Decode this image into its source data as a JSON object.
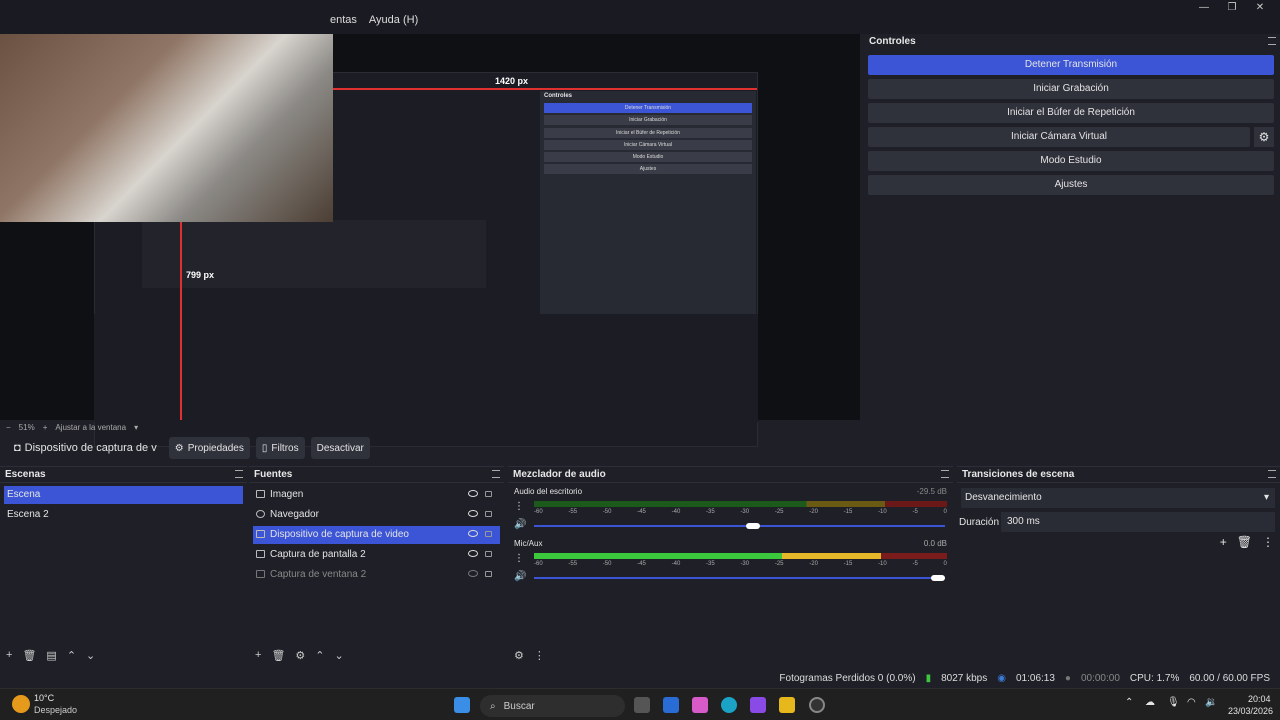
{
  "menu": {
    "items": [
      "entas",
      "Ayuda (H)"
    ]
  },
  "window_controls": {
    "minimize": "—",
    "maximize": "❐",
    "close": "✕"
  },
  "preview": {
    "inner_controls_title": "Controles",
    "inner_buttons": [
      "Detener Transmisión",
      "Iniciar Grabación",
      "Iniciar el Búfer de Repetición",
      "Iniciar Cámara Virtual",
      "Modo Estudio",
      "Ajustes"
    ],
    "measure_h": "1420 px",
    "measure_v": "799 px",
    "zoom": "51%",
    "fit_label": "Ajustar a la ventana"
  },
  "source_toolbar": {
    "source_name": "Dispositivo de captura de v",
    "properties": "Propiedades",
    "filters": "Filtros",
    "deactivate": "Desactivar"
  },
  "controls": {
    "title": "Controles",
    "buttons": [
      "Detener Transmisión",
      "Iniciar Grabación",
      "Iniciar el Búfer de Repetición",
      "Iniciar Cámara Virtual",
      "Modo Estudio",
      "Ajustes"
    ]
  },
  "scenes": {
    "title": "Escenas",
    "items": [
      "Escena",
      "Escena 2"
    ],
    "selected": 0
  },
  "sources": {
    "title": "Fuentes",
    "items": [
      "Imagen",
      "Navegador",
      "Dispositivo de captura de video",
      "Captura de pantalla 2",
      "Captura de ventana 2"
    ],
    "selected": 2
  },
  "mixer": {
    "title": "Mezclador de audio",
    "channels": [
      {
        "name": "Audio del escritorio",
        "db": "-29.5 dB",
        "level": 0.55
      },
      {
        "name": "Mic/Aux",
        "db": "0.0 dB",
        "level": 1.0
      }
    ],
    "scale": [
      "-60",
      "-55",
      "-50",
      "-45",
      "-40",
      "-35",
      "-30",
      "-25",
      "-20",
      "-15",
      "-10",
      "-5",
      "0"
    ]
  },
  "transitions": {
    "title": "Transiciones de escena",
    "type": "Desvanecimiento",
    "duration_label": "Duración",
    "duration_value": "300 ms"
  },
  "statusbar": {
    "dropped": "Fotogramas Perdidos 0 (0.0%)",
    "bitrate": "8027 kbps",
    "stream_time": "01:06:13",
    "rec_time": "00:00:00",
    "cpu": "CPU: 1.7%",
    "fps": "60.00 / 60.00 FPS"
  },
  "taskbar": {
    "weather_temp": "10°C",
    "weather_desc": "Despejado",
    "search": "Buscar",
    "time": "20:04",
    "date": "23/03/2026"
  },
  "colors": {
    "accent": "#3b55d6",
    "panel": "#1e1f27",
    "button": "#2f313b"
  }
}
